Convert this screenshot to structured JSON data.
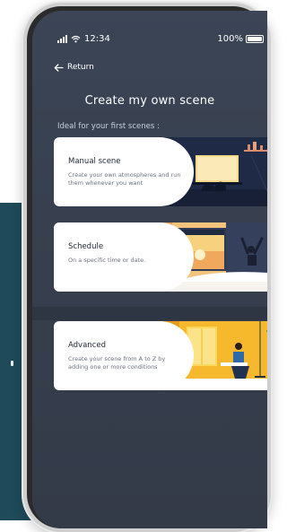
{
  "status": {
    "time": "12:34",
    "battery": "100%"
  },
  "nav": {
    "return_label": "Return"
  },
  "page": {
    "title": "Create my own scene",
    "subtitle": "Ideal for your first scenes :"
  },
  "cards": [
    {
      "title": "Manual scene",
      "description": "Create your own atmospheres and run them whenever you want"
    },
    {
      "title": "Schedule",
      "description": "On a specific time or date."
    },
    {
      "title": "Advanced",
      "description": "Create your scene from A to Z by adding one or more conditions"
    }
  ],
  "colors": {
    "screen_bg": "#38404f",
    "card_bg": "#ffffff",
    "side_panel": "#1f4a5a"
  },
  "icons": [
    "signal-icon",
    "wifi-icon",
    "battery-icon",
    "arrow-left-icon"
  ]
}
